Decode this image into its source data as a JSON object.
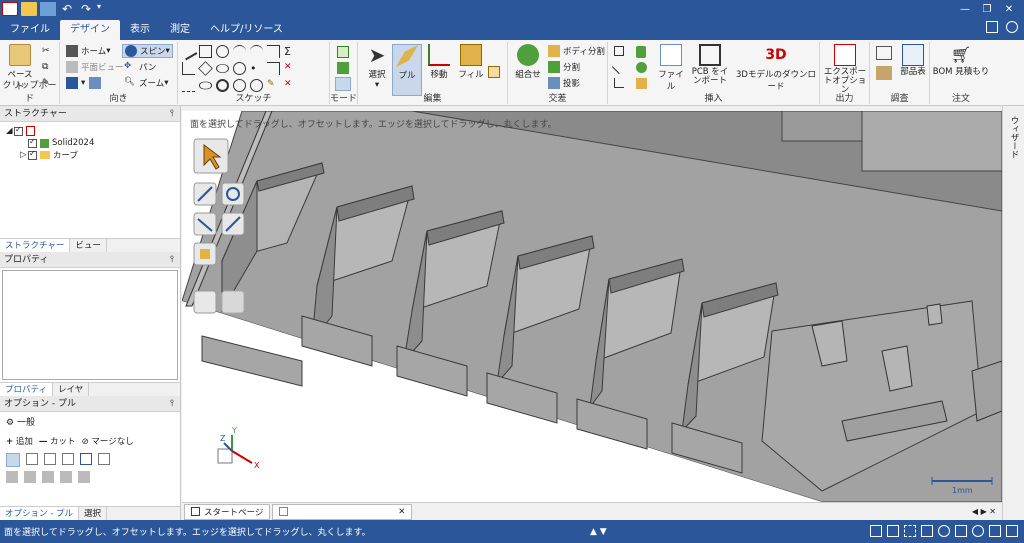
{
  "title_bar": {
    "quick_access_icons": [
      "app-icon",
      "folder-icon",
      "save-icon",
      "undo-icon",
      "redo-icon",
      "customize-icon"
    ],
    "window_controls": [
      "minimize-icon",
      "restore-icon",
      "close-icon"
    ]
  },
  "tabs": [
    {
      "label": "ファイル",
      "active": false
    },
    {
      "label": "デザイン",
      "active": true
    },
    {
      "label": "表示",
      "active": false
    },
    {
      "label": "測定",
      "active": false
    },
    {
      "label": "ヘルプ/リソース",
      "active": false
    }
  ],
  "ribbon": {
    "clipboard": {
      "label": "クリップボード",
      "paste": "ペースト"
    },
    "orient": {
      "label": "向き",
      "home": "ホーム",
      "plane_view": "平面ビュー",
      "spin": "スピン",
      "pan": "パン",
      "zoom": "ズーム"
    },
    "sketch": {
      "label": "スケッチ"
    },
    "mode": {
      "label": "モード"
    },
    "edit": {
      "label": "編集",
      "select": "選択",
      "pull": "プル",
      "move": "移動",
      "fill": "フィル"
    },
    "intersect": {
      "label": "交差",
      "combine": "組合せ",
      "body_split": "ボディ分割",
      "split": "分割",
      "project": "投影"
    },
    "insert": {
      "label": "挿入",
      "file": "ファイル",
      "pcb": "PCB をインポート",
      "model_download": "3Dモデルのダウンロード"
    },
    "output": {
      "label": "出力",
      "export_options": "エクスポートオプション"
    },
    "investigate": {
      "label": "調査",
      "parts_table": "部品表"
    },
    "order": {
      "label": "注文",
      "bom": "BOM 見積もり"
    }
  },
  "left_panel": {
    "structure_title": "ストラクチャー",
    "tree": [
      {
        "label": "Solid2024",
        "level": 1
      },
      {
        "label": "カーブ",
        "level": 1
      }
    ],
    "structure_tabs": [
      "ストラクチャー",
      "ビュー"
    ],
    "properties_title": "プロパティ",
    "property_tabs": [
      "プロパティ",
      "レイヤ"
    ],
    "options_title": "オプション - プル",
    "general_label": "一般",
    "option_items": [
      "追加",
      "カット",
      "マージなし"
    ],
    "bottom_tabs": [
      "オプション - プル",
      "選択"
    ]
  },
  "viewport": {
    "hint": "面を選択してドラッグし、オフセットします。エッジを選択してドラッグし、丸くします。",
    "scale_label": "1mm",
    "axes": [
      "X",
      "Y",
      "Z"
    ]
  },
  "right_panel_label": "ウィザード",
  "doc_tabs": [
    {
      "label": "スタートページ"
    },
    {
      "label": ""
    }
  ],
  "status_text": "面を選択してドラッグし、オフセットします。エッジを選択してドラッグし、丸くします。",
  "colors": {
    "titlebar": "#2b579a",
    "ribbon": "#f5f5f5",
    "model_face": "#a9a9a9"
  }
}
